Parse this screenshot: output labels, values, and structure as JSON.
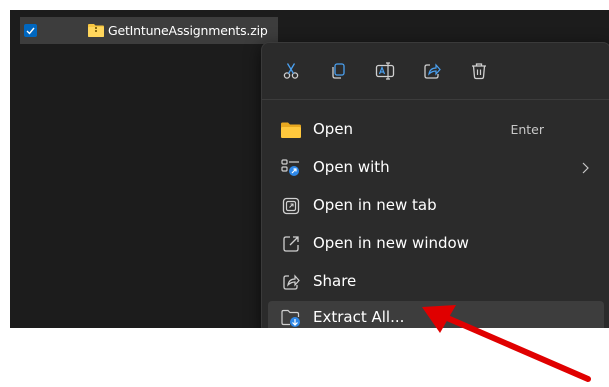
{
  "file": {
    "name": "GetIntuneAssignments.zip",
    "selected": true
  },
  "toolbar": {
    "buttons": [
      {
        "name": "cut",
        "icon": "scissors-icon"
      },
      {
        "name": "copy",
        "icon": "copy-icon"
      },
      {
        "name": "rename",
        "icon": "rename-icon"
      },
      {
        "name": "share",
        "icon": "share-icon"
      },
      {
        "name": "delete",
        "icon": "trash-icon"
      }
    ]
  },
  "menu": {
    "items": [
      {
        "label": "Open",
        "shortcut": "Enter",
        "icon": "folder-icon"
      },
      {
        "label": "Open with",
        "icon": "open-with-icon",
        "submenu": true
      },
      {
        "label": "Open in new tab",
        "icon": "new-tab-icon"
      },
      {
        "label": "Open in new window",
        "icon": "new-window-icon"
      },
      {
        "label": "Share",
        "icon": "share-icon"
      },
      {
        "label": "Extract All...",
        "icon": "extract-icon",
        "highlighted": true
      }
    ]
  },
  "colors": {
    "accent": "#0067c0",
    "annotation_arrow": "#e00000",
    "menu_bg": "#2b2b2b",
    "explorer_bg": "#1c1c1c"
  }
}
